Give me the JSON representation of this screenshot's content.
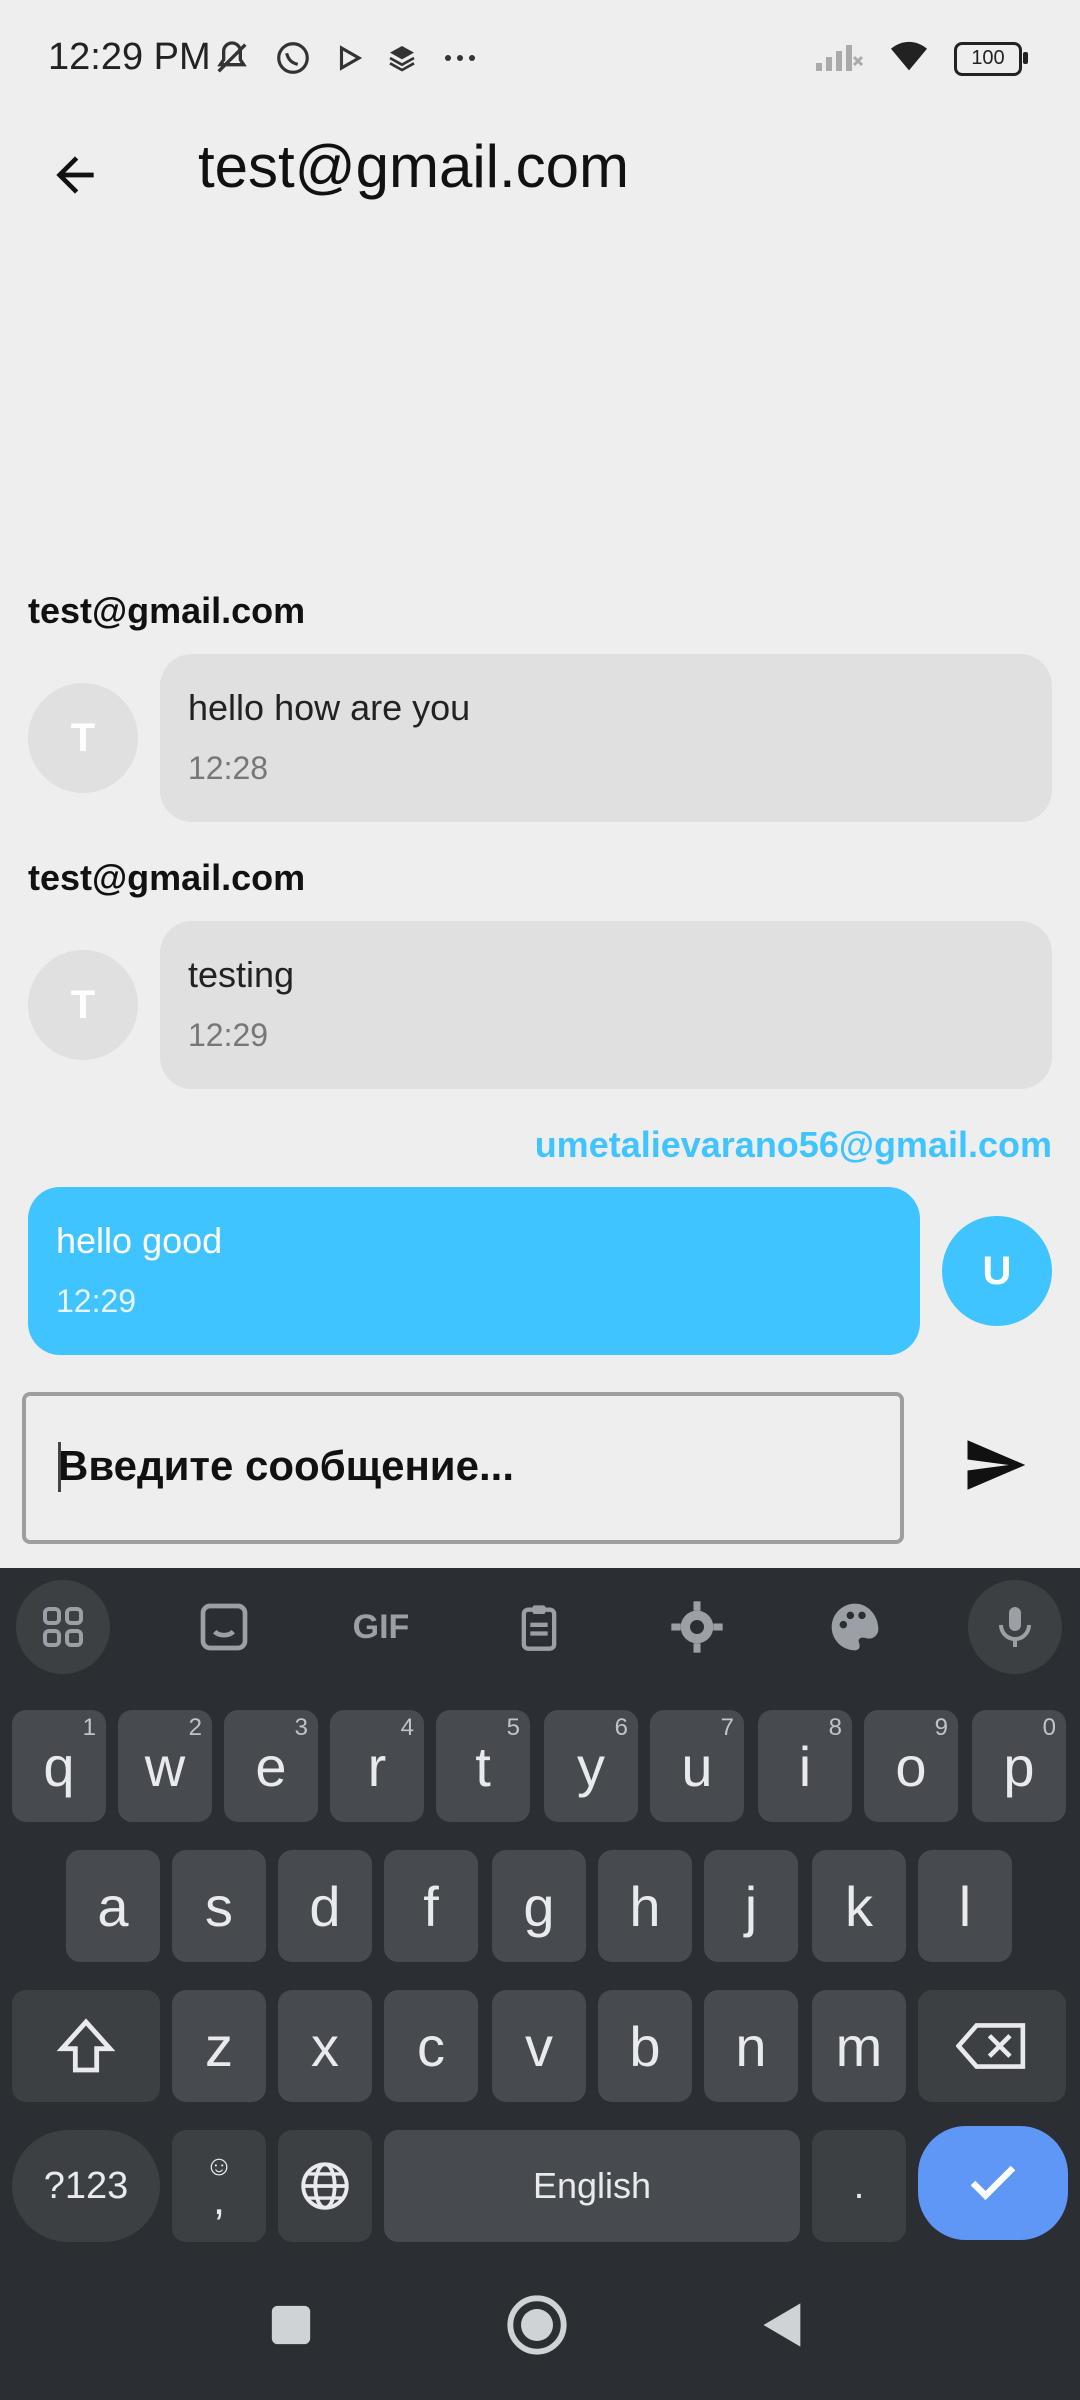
{
  "status_bar": {
    "time": "12:29 PM",
    "battery": "100"
  },
  "app_bar": {
    "title": "test@gmail.com"
  },
  "messages": [
    {
      "sender": "test@gmail.com",
      "avatar": "T",
      "text": "hello how are you",
      "time": "12:28",
      "mine": false
    },
    {
      "sender": "test@gmail.com",
      "avatar": "T",
      "text": "testing",
      "time": "12:29",
      "mine": false
    },
    {
      "sender": "umetalievarano56@gmail.com",
      "avatar": "U",
      "text": "hello good",
      "time": "12:29",
      "mine": true
    }
  ],
  "composer": {
    "placeholder": "Введите сообщение..."
  },
  "keyboard": {
    "row1": [
      {
        "k": "q",
        "h": "1"
      },
      {
        "k": "w",
        "h": "2"
      },
      {
        "k": "e",
        "h": "3"
      },
      {
        "k": "r",
        "h": "4"
      },
      {
        "k": "t",
        "h": "5"
      },
      {
        "k": "y",
        "h": "6"
      },
      {
        "k": "u",
        "h": "7"
      },
      {
        "k": "i",
        "h": "8"
      },
      {
        "k": "o",
        "h": "9"
      },
      {
        "k": "p",
        "h": "0"
      }
    ],
    "row2": [
      "a",
      "s",
      "d",
      "f",
      "g",
      "h",
      "j",
      "k",
      "l"
    ],
    "row3": [
      "z",
      "x",
      "c",
      "v",
      "b",
      "n",
      "m"
    ],
    "symbols_label": "?123",
    "comma_label": ",",
    "space_label": "English",
    "period_label": ".",
    "toolbar_gif": "GIF"
  },
  "colors": {
    "accent": "#40c4ff",
    "enter_key": "#5e97f6"
  }
}
